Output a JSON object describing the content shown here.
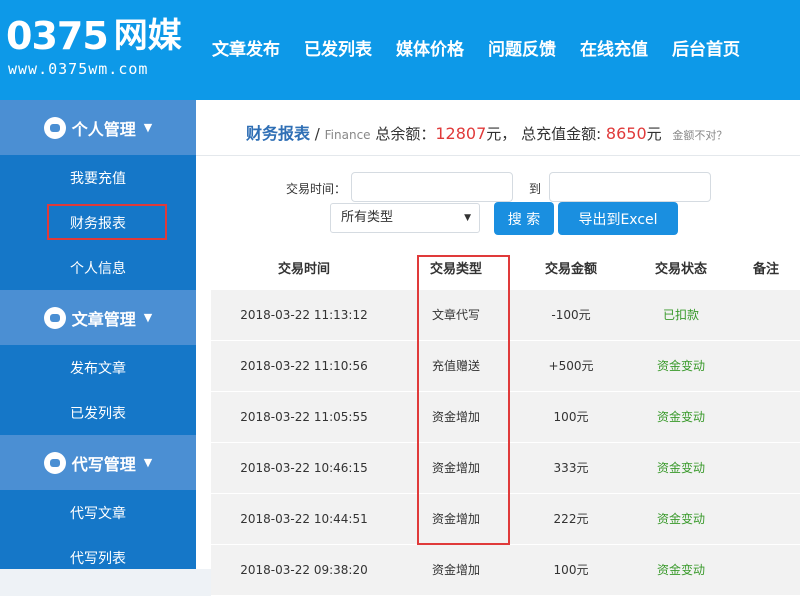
{
  "logo": {
    "digits": "0375",
    "cn": "网媒",
    "url": "www.0375wm.com"
  },
  "nav": [
    "文章发布",
    "已发列表",
    "媒体价格",
    "问题反馈",
    "在线充值",
    "后台首页"
  ],
  "sidebar": {
    "groups": [
      {
        "label": "个人管理",
        "items": [
          "我要充值",
          "财务报表",
          "个人信息"
        ]
      },
      {
        "label": "文章管理",
        "items": [
          "发布文章",
          "已发列表"
        ]
      },
      {
        "label": "代写管理",
        "items": [
          "代写文章",
          "代写列表"
        ]
      }
    ]
  },
  "breadcrumb": {
    "title": "财务报表",
    "sep": "/",
    "sub": "Finance",
    "balance_label": "总余额：",
    "balance_value": "12807",
    "balance_unit": "元，",
    "recharge_label": "总充值金额:",
    "recharge_value": "8650",
    "recharge_unit": "元",
    "question": "金额不对？"
  },
  "filter": {
    "time_label": "交易时间：",
    "to_label": "到",
    "type_selected": "所有类型",
    "search_btn": "搜 索",
    "export_btn": "导出到Excel"
  },
  "table": {
    "headers": [
      "交易时间",
      "交易类型",
      "交易金额",
      "交易状态",
      "备注"
    ],
    "rows": [
      [
        "2018-03-22 11:13:12",
        "文章代写",
        "-100元",
        "已扣款",
        ""
      ],
      [
        "2018-03-22 11:10:56",
        "充值赠送",
        "+500元",
        "资金变动",
        ""
      ],
      [
        "2018-03-22 11:05:55",
        "资金增加",
        "100元",
        "资金变动",
        ""
      ],
      [
        "2018-03-22 10:46:15",
        "资金增加",
        "333元",
        "资金变动",
        ""
      ],
      [
        "2018-03-22 10:44:51",
        "资金增加",
        "222元",
        "资金变动",
        ""
      ],
      [
        "2018-03-22 09:38:20",
        "资金增加",
        "100元",
        "资金变动",
        ""
      ]
    ]
  },
  "colors": {
    "header": "#0d99e8",
    "sidebar": "#1577c8",
    "sidebar_group": "#4b8fd3",
    "highlight": "#e03a3a",
    "status": "#3a9a2c"
  }
}
